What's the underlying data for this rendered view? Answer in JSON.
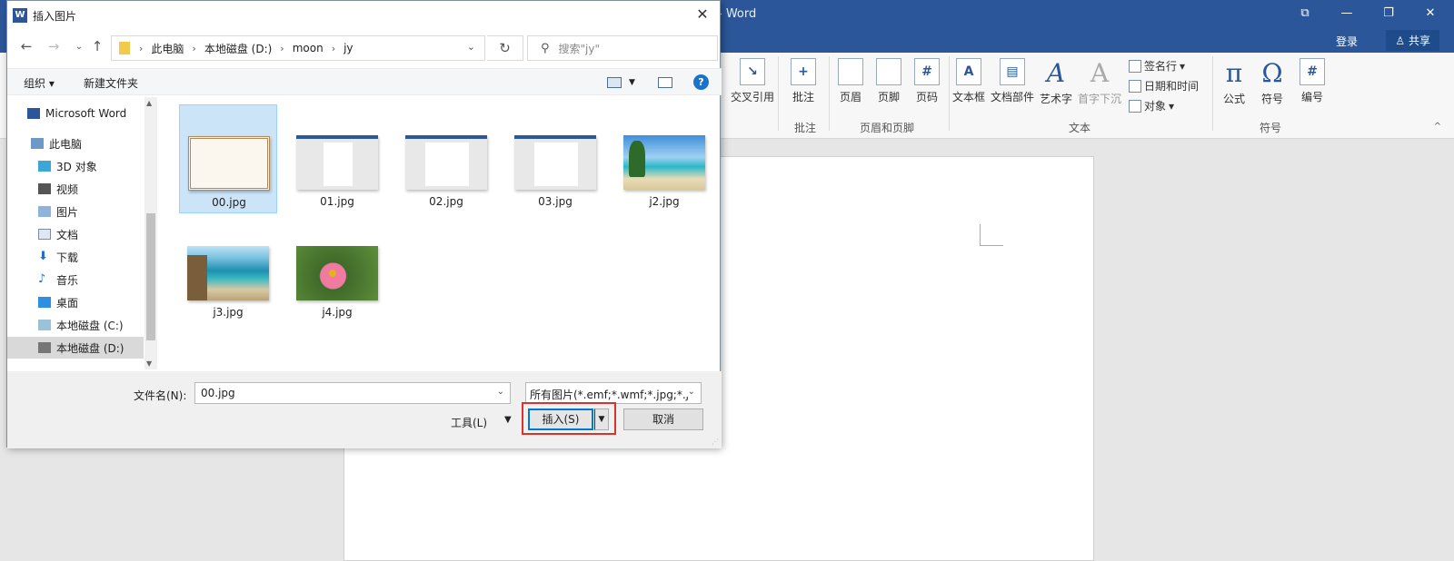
{
  "word": {
    "title": "- Word",
    "login": "登录",
    "share": "共享",
    "ribbon": {
      "cross_ref": "交叉引用",
      "comment": "批注",
      "comment_group": "批注",
      "header": "页眉",
      "footer": "页脚",
      "page_number": "页码",
      "hf_group": "页眉和页脚",
      "textbox": "文本框",
      "quick_parts": "文档部件",
      "wordart": "艺术字",
      "dropcap": "首字下沉",
      "signature": "签名行",
      "datetime": "日期和时间",
      "object": "对象",
      "text_group": "文本",
      "equation": "公式",
      "symbol": "符号",
      "numbering": "编号",
      "symbols_group": "符号"
    }
  },
  "dialog": {
    "title": "插入图片",
    "breadcrumb": [
      "此电脑",
      "本地磁盘 (D:)",
      "moon",
      "jy"
    ],
    "search_placeholder": "搜索\"jy\"",
    "toolbar": {
      "organize": "组织 ▾",
      "new_folder": "新建文件夹"
    },
    "sidebar": [
      {
        "label": "Microsoft Word",
        "icon": "word-icon"
      },
      {
        "label": "此电脑",
        "icon": "computer-icon"
      },
      {
        "label": "3D 对象",
        "icon": "3d-objects-icon"
      },
      {
        "label": "视频",
        "icon": "video-icon"
      },
      {
        "label": "图片",
        "icon": "pictures-icon"
      },
      {
        "label": "文档",
        "icon": "documents-icon"
      },
      {
        "label": "下载",
        "icon": "download-icon"
      },
      {
        "label": "音乐",
        "icon": "music-icon"
      },
      {
        "label": "桌面",
        "icon": "desktop-icon"
      },
      {
        "label": "本地磁盘 (C:)",
        "icon": "drive-c-icon"
      },
      {
        "label": "本地磁盘 (D:)",
        "icon": "drive-d-icon"
      }
    ],
    "files": [
      {
        "name": "00.jpg",
        "kind": "certificate"
      },
      {
        "name": "01.jpg",
        "kind": "screenshot"
      },
      {
        "name": "02.jpg",
        "kind": "screenshot"
      },
      {
        "name": "03.jpg",
        "kind": "screenshot"
      },
      {
        "name": "j2.jpg",
        "kind": "beach"
      },
      {
        "name": "j3.jpg",
        "kind": "coast"
      },
      {
        "name": "j4.jpg",
        "kind": "flower"
      }
    ],
    "filename_label": "文件名(N):",
    "filename_value": "00.jpg",
    "filter_value": "所有图片(*.emf;*.wmf;*.jpg;*.j",
    "tools_label": "工具(L)",
    "insert_label": "插入(S)",
    "cancel_label": "取消"
  },
  "colors": {
    "word_blue": "#2b579a",
    "selection": "#cce4f7",
    "highlight_red": "#d9342b"
  }
}
